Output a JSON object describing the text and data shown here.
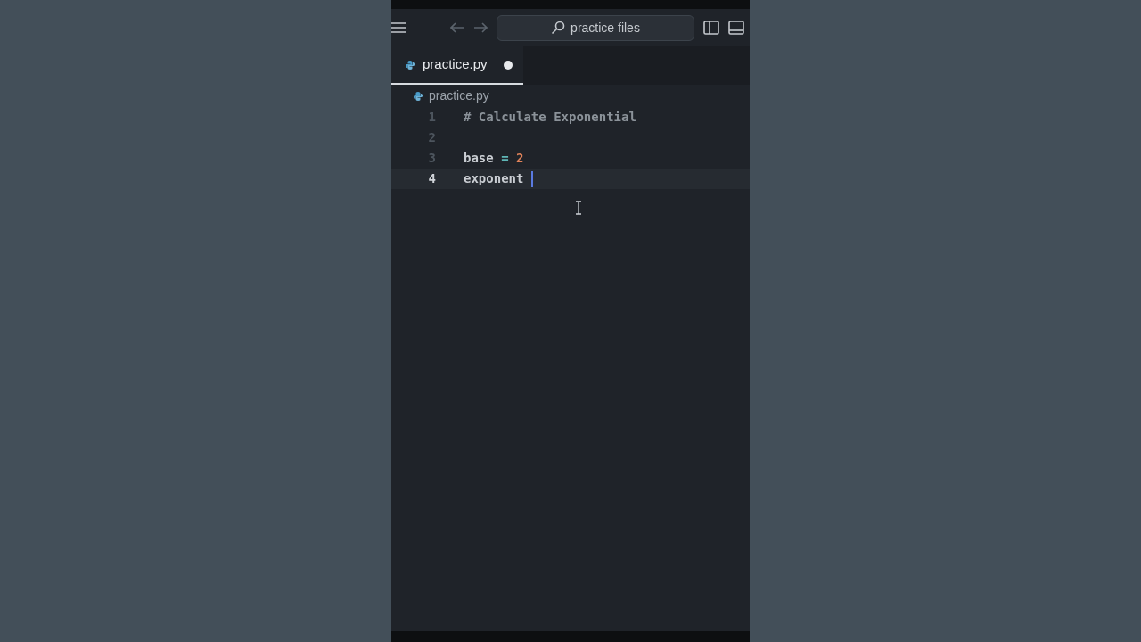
{
  "titlebar": {
    "search_text": "practice files"
  },
  "tabs": [
    {
      "label": "practice.py",
      "selected": true,
      "modified": true
    }
  ],
  "breadcrumb": {
    "file": "practice.py"
  },
  "editor": {
    "lines": [
      {
        "number": "1",
        "current": false,
        "tokens": [
          {
            "kind": "comment",
            "text": "# Calculate Exponential"
          }
        ]
      },
      {
        "number": "2",
        "current": false
      },
      {
        "number": "3",
        "current": false,
        "tokens": [
          {
            "kind": "name",
            "text": "base"
          },
          {
            "kind": "op",
            "text": " = "
          },
          {
            "kind": "number",
            "text": "2"
          }
        ]
      },
      {
        "number": "4",
        "current": true,
        "tokens": [
          {
            "kind": "name",
            "text": "exponent "
          }
        ]
      }
    ]
  }
}
